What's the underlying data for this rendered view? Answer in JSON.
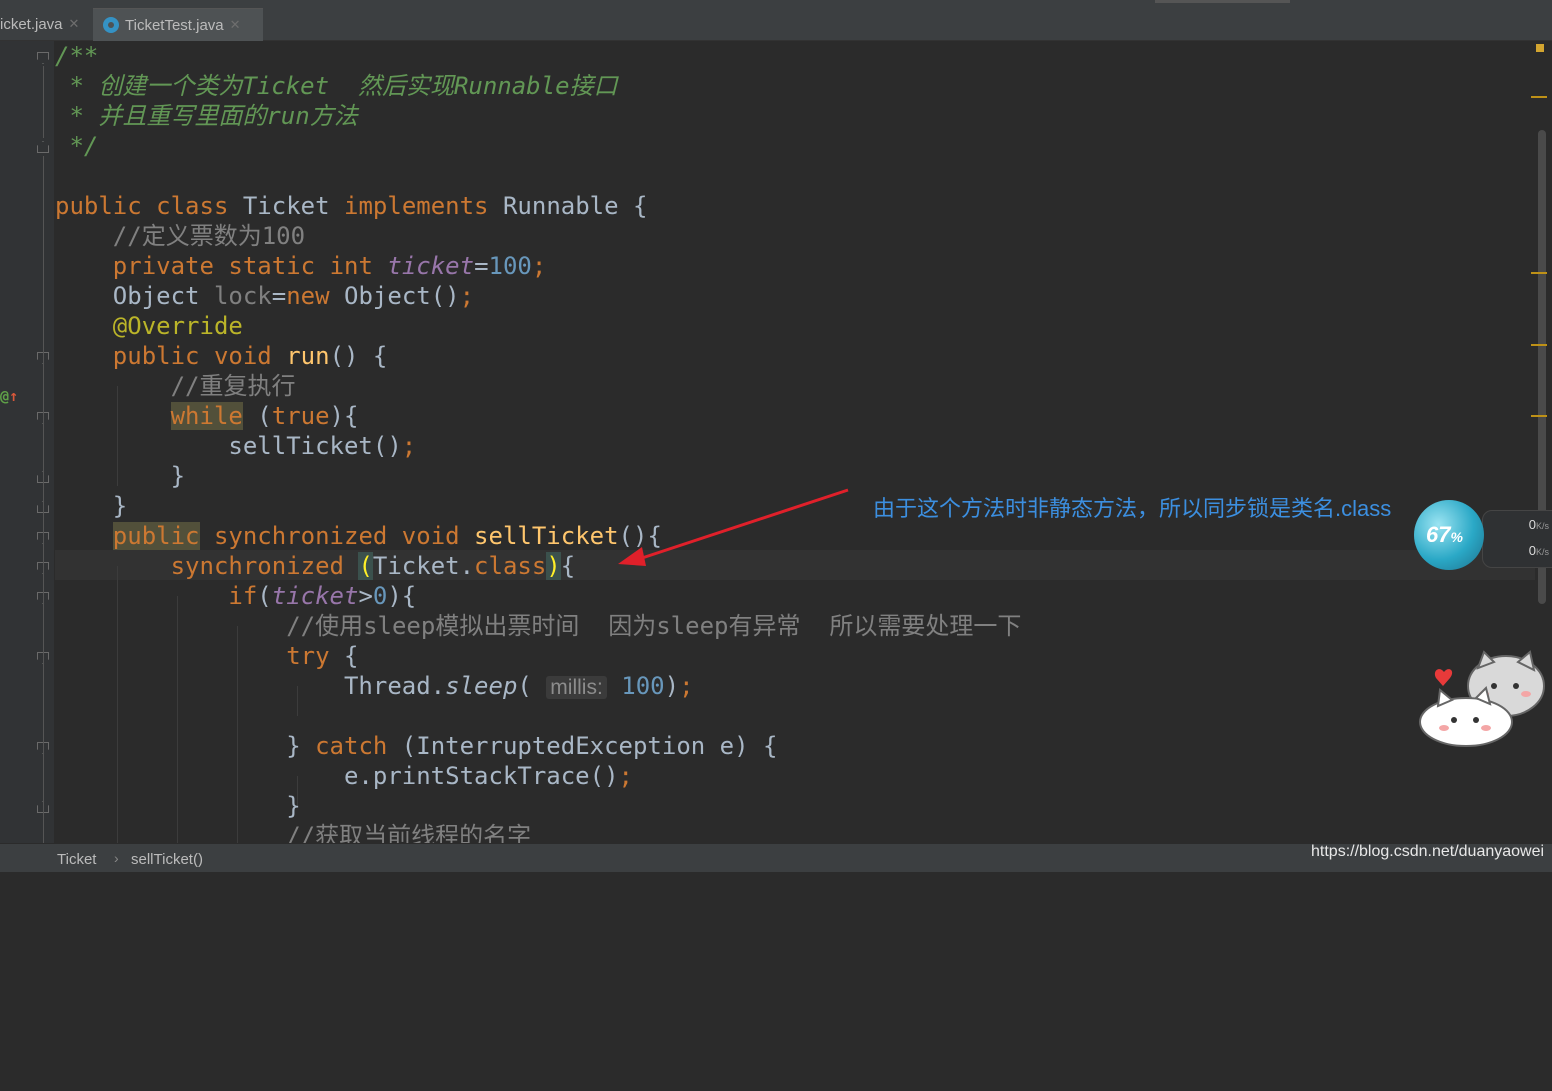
{
  "tabs": [
    {
      "label": "icket.java"
    },
    {
      "label": "TicketTest.java"
    }
  ],
  "code": {
    "doc1": "/**",
    "doc2": " * 创建一个类为Ticket  然后实现Runnable接口",
    "doc3": " * 并且重写里面的run方法",
    "doc4": " */",
    "kw_public": "public",
    "kw_class": "class",
    "class_name": "Ticket",
    "kw_implements": "implements",
    "iface": "Runnable",
    "cm_count": "//定义票数为100",
    "kw_private": "private",
    "kw_static": "static",
    "kw_int": "int",
    "field_ticket": "ticket",
    "num_100": "100",
    "type_object": "Object",
    "field_lock": "lock",
    "kw_new": "new",
    "ctor_object": "Object()",
    "annotation": "@Override",
    "kw_void": "void",
    "method_run": "run",
    "cm_repeat": "//重复执行",
    "kw_while": "while",
    "kw_true": "true",
    "call_sell": "sellTicket()",
    "kw_synchronized": "synchronized",
    "method_sell": "sellTicket",
    "class_ref": "Ticket.",
    "kw_if": "if",
    "cm_sleep": "//使用sleep模拟出票时间  因为sleep有异常  所以需要处理一下",
    "kw_try": "try",
    "thread": "Thread.",
    "sleep": "sleep",
    "hint_millis": "millis:",
    "kw_catch": "catch",
    "exception": "(InterruptedException e) {",
    "print_trace": "e.printStackTrace()",
    "cm_name": "//获取当前线程的名字"
  },
  "callout": "由于这个方法时非静态方法，所以同步锁是类名.class",
  "widget": {
    "percent": "67",
    "percent_sign": "%",
    "up_speed": "0",
    "down_speed": "0",
    "unit": "K/s"
  },
  "breadcrumb": {
    "class": "Ticket",
    "method": "sellTicket()"
  },
  "watermark": "https://blog.csdn.net/duanyaowei",
  "colors": {
    "keyword": "#cc7832",
    "doc": "#629755",
    "comment": "#808080",
    "number": "#6897bb",
    "annotation": "#bbb529",
    "field": "#9876aa",
    "method": "#ffc66d",
    "callout": "#3c8fe0",
    "arrow": "#e0202a"
  }
}
